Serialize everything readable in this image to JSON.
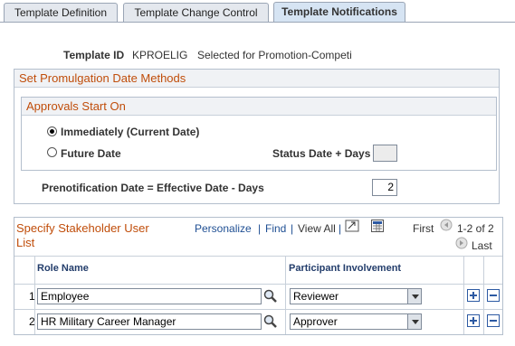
{
  "tabs": [
    {
      "label": "Template Definition",
      "active": false
    },
    {
      "label": "Template Change Control",
      "active": false
    },
    {
      "label": "Template Notifications",
      "active": true
    }
  ],
  "template": {
    "id_label": "Template ID",
    "id_value": "KPROELIG",
    "description": "Selected for Promotion-Competi"
  },
  "promulgation": {
    "title": "Set Promulgation Date Methods",
    "approvals": {
      "title": "Approvals Start On",
      "options": [
        {
          "label": "Immediately (Current Date)",
          "selected": true
        },
        {
          "label": "Future Date",
          "selected": false
        }
      ],
      "status_date_label": "Status Date + Days",
      "status_date_value": ""
    },
    "prenotification_label": "Prenotification Date = Effective Date - Days",
    "prenotification_value": "2"
  },
  "stakeholders": {
    "title_line1": "Specify Stakeholder User",
    "title_line2": "List",
    "toolbar": {
      "personalize": "Personalize",
      "find": "Find",
      "view_all": "View All",
      "sep": "|",
      "first": "First",
      "range": "1-2 of 2",
      "last": "Last"
    },
    "columns": {
      "role_name": "Role Name",
      "participant": "Participant Involvement"
    },
    "rows": [
      {
        "num": "1",
        "role": "Employee",
        "involvement": "Reviewer"
      },
      {
        "num": "2",
        "role": "HR Military Career Manager",
        "involvement": "Approver"
      }
    ]
  },
  "icons": {
    "lookup": "magnifier-icon",
    "add": "plus-icon",
    "delete": "minus-icon",
    "zoom": "expand-grid-icon",
    "download": "spreadsheet-icon",
    "prev": "prev-arrow-icon",
    "next": "next-arrow-icon"
  },
  "colors": {
    "section_title": "#c04d0a",
    "link": "#1f4f93",
    "grid_header": "#233d6b"
  }
}
